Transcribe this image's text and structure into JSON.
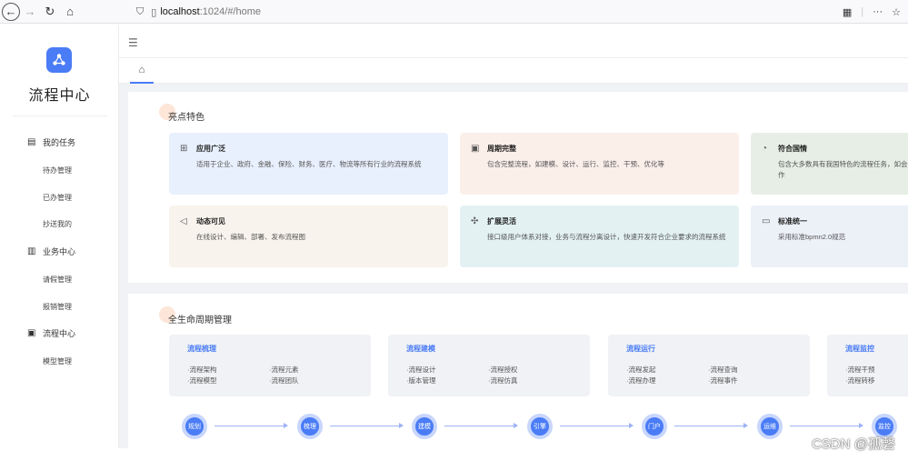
{
  "browser": {
    "back": "←",
    "forward": "→",
    "reload": "↻",
    "home": "⌂",
    "shield": "⛉",
    "page": "▯",
    "url_host": "localhost",
    "url_path": ":1024/#/home",
    "qr": "▦",
    "more": "···",
    "star": "☆"
  },
  "sidebar": {
    "title": "流程中心",
    "groups": [
      {
        "icon": "▤",
        "label": "我的任务",
        "items": [
          "待办管理",
          "已办管理",
          "抄送我的"
        ]
      },
      {
        "icon": "▥",
        "label": "业务中心",
        "items": [
          "请假管理",
          "报销管理"
        ]
      },
      {
        "icon": "▣",
        "label": "流程中心",
        "items": [
          "模型管理"
        ]
      }
    ]
  },
  "topbar": {
    "menu_icon": "☰",
    "home_icon": "⌂"
  },
  "features": {
    "title": "亮点特色",
    "cards": [
      {
        "icon": "⊞",
        "title": "应用广泛",
        "desc": "适用于企业、政府、金融、保险、财务、医疗、物流等所有行业的流程系统",
        "color": "#e8f0fd"
      },
      {
        "icon": "▣",
        "title": "周期完整",
        "desc": "包含完整流程，如建模、设计、运行、监控、干预、优化等",
        "color": "#fbefea"
      },
      {
        "icon": "◔",
        "title": "符合国情",
        "desc": "包含大多数具有我国特色的流程任务，如会签、加签、减签、回退、转办、委派等操作",
        "color": "#e7eee6"
      },
      {
        "icon": "◁",
        "title": "动态可见",
        "desc": "在线设计、编辑、部署、发布流程图",
        "color": "#f8f3ec"
      },
      {
        "icon": "✣",
        "title": "扩展灵活",
        "desc": "接口级用户体系对接，业务与流程分离设计，快速开发符合企业要求的流程系统",
        "color": "#e3f1f3"
      },
      {
        "icon": "▭",
        "title": "标准统一",
        "desc": "采用标准bpmn2.0规范",
        "color": "#ecf0f7"
      }
    ]
  },
  "lifecycle": {
    "title": "全生命周期管理",
    "cards": [
      {
        "title": "流程梳理",
        "col1": [
          "·流程架构",
          "·流程模型"
        ],
        "col2": [
          "·流程元素",
          "·流程团队"
        ]
      },
      {
        "title": "流程建模",
        "col1": [
          "·流程设计",
          "·版本管理"
        ],
        "col2": [
          "·流程授权",
          "·流程仿真"
        ]
      },
      {
        "title": "流程运行",
        "col1": [
          "·流程发起",
          "·流程办理"
        ],
        "col2": [
          "·流程查询",
          "·流程事件"
        ]
      },
      {
        "title": "流程监控",
        "col1": [
          "·流程干预",
          "·流程转移"
        ],
        "col2": []
      }
    ],
    "steps": [
      "规划",
      "梳理",
      "建模",
      "引擎",
      "门户",
      "运维",
      "监控"
    ]
  },
  "watermark": "CSDN @孤磬"
}
